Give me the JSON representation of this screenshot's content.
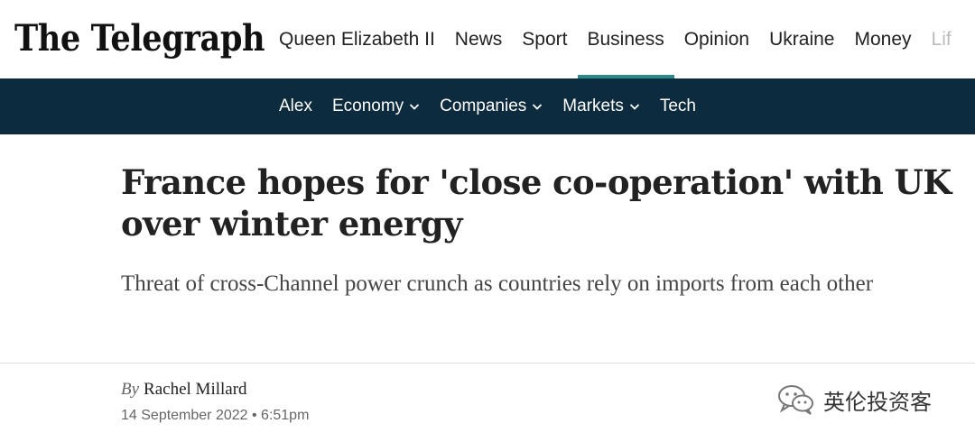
{
  "header": {
    "logo": "The Telegraph",
    "nav": [
      {
        "label": "Queen Elizabeth II"
      },
      {
        "label": "News"
      },
      {
        "label": "Sport"
      },
      {
        "label": "Business",
        "active": true
      },
      {
        "label": "Opinion"
      },
      {
        "label": "Ukraine"
      },
      {
        "label": "Money"
      },
      {
        "label": "Lif"
      }
    ]
  },
  "subnav": [
    {
      "label": "Alex",
      "dropdown": false
    },
    {
      "label": "Economy",
      "dropdown": true
    },
    {
      "label": "Companies",
      "dropdown": true
    },
    {
      "label": "Markets",
      "dropdown": true
    },
    {
      "label": "Tech",
      "dropdown": false
    }
  ],
  "article": {
    "headline": "France hopes for 'close co-operation' with UK over winter energy",
    "standfirst": "Threat of cross-Channel power crunch as countries rely on imports from each other",
    "byline_prefix": "By",
    "author": "Rachel Millard",
    "date": "14 September 2022 • 6:51pm"
  },
  "watermark": {
    "text": "英伦投资客",
    "icon": "wechat-icon"
  },
  "colors": {
    "subnav_bg": "#0d2b3e",
    "active_underline": "#2a8c8a"
  }
}
